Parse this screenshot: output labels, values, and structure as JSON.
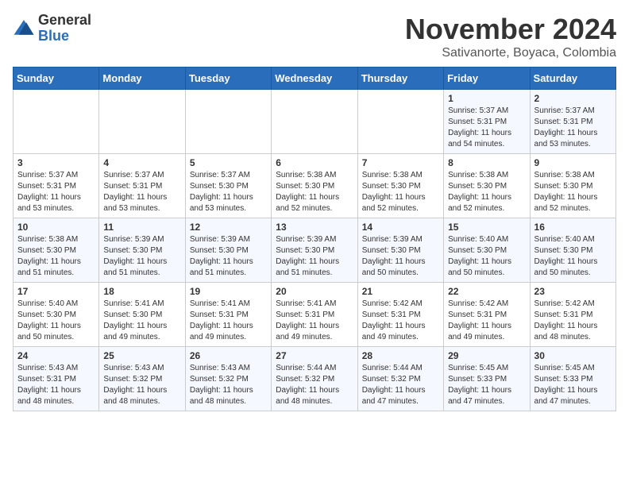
{
  "logo": {
    "general": "General",
    "blue": "Blue"
  },
  "header": {
    "title": "November 2024",
    "subtitle": "Sativanorte, Boyaca, Colombia"
  },
  "weekdays": [
    "Sunday",
    "Monday",
    "Tuesday",
    "Wednesday",
    "Thursday",
    "Friday",
    "Saturday"
  ],
  "weeks": [
    [
      {
        "day": "",
        "info": ""
      },
      {
        "day": "",
        "info": ""
      },
      {
        "day": "",
        "info": ""
      },
      {
        "day": "",
        "info": ""
      },
      {
        "day": "",
        "info": ""
      },
      {
        "day": "1",
        "info": "Sunrise: 5:37 AM\nSunset: 5:31 PM\nDaylight: 11 hours\nand 54 minutes."
      },
      {
        "day": "2",
        "info": "Sunrise: 5:37 AM\nSunset: 5:31 PM\nDaylight: 11 hours\nand 53 minutes."
      }
    ],
    [
      {
        "day": "3",
        "info": "Sunrise: 5:37 AM\nSunset: 5:31 PM\nDaylight: 11 hours\nand 53 minutes."
      },
      {
        "day": "4",
        "info": "Sunrise: 5:37 AM\nSunset: 5:31 PM\nDaylight: 11 hours\nand 53 minutes."
      },
      {
        "day": "5",
        "info": "Sunrise: 5:37 AM\nSunset: 5:30 PM\nDaylight: 11 hours\nand 53 minutes."
      },
      {
        "day": "6",
        "info": "Sunrise: 5:38 AM\nSunset: 5:30 PM\nDaylight: 11 hours\nand 52 minutes."
      },
      {
        "day": "7",
        "info": "Sunrise: 5:38 AM\nSunset: 5:30 PM\nDaylight: 11 hours\nand 52 minutes."
      },
      {
        "day": "8",
        "info": "Sunrise: 5:38 AM\nSunset: 5:30 PM\nDaylight: 11 hours\nand 52 minutes."
      },
      {
        "day": "9",
        "info": "Sunrise: 5:38 AM\nSunset: 5:30 PM\nDaylight: 11 hours\nand 52 minutes."
      }
    ],
    [
      {
        "day": "10",
        "info": "Sunrise: 5:38 AM\nSunset: 5:30 PM\nDaylight: 11 hours\nand 51 minutes."
      },
      {
        "day": "11",
        "info": "Sunrise: 5:39 AM\nSunset: 5:30 PM\nDaylight: 11 hours\nand 51 minutes."
      },
      {
        "day": "12",
        "info": "Sunrise: 5:39 AM\nSunset: 5:30 PM\nDaylight: 11 hours\nand 51 minutes."
      },
      {
        "day": "13",
        "info": "Sunrise: 5:39 AM\nSunset: 5:30 PM\nDaylight: 11 hours\nand 51 minutes."
      },
      {
        "day": "14",
        "info": "Sunrise: 5:39 AM\nSunset: 5:30 PM\nDaylight: 11 hours\nand 50 minutes."
      },
      {
        "day": "15",
        "info": "Sunrise: 5:40 AM\nSunset: 5:30 PM\nDaylight: 11 hours\nand 50 minutes."
      },
      {
        "day": "16",
        "info": "Sunrise: 5:40 AM\nSunset: 5:30 PM\nDaylight: 11 hours\nand 50 minutes."
      }
    ],
    [
      {
        "day": "17",
        "info": "Sunrise: 5:40 AM\nSunset: 5:30 PM\nDaylight: 11 hours\nand 50 minutes."
      },
      {
        "day": "18",
        "info": "Sunrise: 5:41 AM\nSunset: 5:30 PM\nDaylight: 11 hours\nand 49 minutes."
      },
      {
        "day": "19",
        "info": "Sunrise: 5:41 AM\nSunset: 5:31 PM\nDaylight: 11 hours\nand 49 minutes."
      },
      {
        "day": "20",
        "info": "Sunrise: 5:41 AM\nSunset: 5:31 PM\nDaylight: 11 hours\nand 49 minutes."
      },
      {
        "day": "21",
        "info": "Sunrise: 5:42 AM\nSunset: 5:31 PM\nDaylight: 11 hours\nand 49 minutes."
      },
      {
        "day": "22",
        "info": "Sunrise: 5:42 AM\nSunset: 5:31 PM\nDaylight: 11 hours\nand 49 minutes."
      },
      {
        "day": "23",
        "info": "Sunrise: 5:42 AM\nSunset: 5:31 PM\nDaylight: 11 hours\nand 48 minutes."
      }
    ],
    [
      {
        "day": "24",
        "info": "Sunrise: 5:43 AM\nSunset: 5:31 PM\nDaylight: 11 hours\nand 48 minutes."
      },
      {
        "day": "25",
        "info": "Sunrise: 5:43 AM\nSunset: 5:32 PM\nDaylight: 11 hours\nand 48 minutes."
      },
      {
        "day": "26",
        "info": "Sunrise: 5:43 AM\nSunset: 5:32 PM\nDaylight: 11 hours\nand 48 minutes."
      },
      {
        "day": "27",
        "info": "Sunrise: 5:44 AM\nSunset: 5:32 PM\nDaylight: 11 hours\nand 48 minutes."
      },
      {
        "day": "28",
        "info": "Sunrise: 5:44 AM\nSunset: 5:32 PM\nDaylight: 11 hours\nand 47 minutes."
      },
      {
        "day": "29",
        "info": "Sunrise: 5:45 AM\nSunset: 5:33 PM\nDaylight: 11 hours\nand 47 minutes."
      },
      {
        "day": "30",
        "info": "Sunrise: 5:45 AM\nSunset: 5:33 PM\nDaylight: 11 hours\nand 47 minutes."
      }
    ]
  ]
}
